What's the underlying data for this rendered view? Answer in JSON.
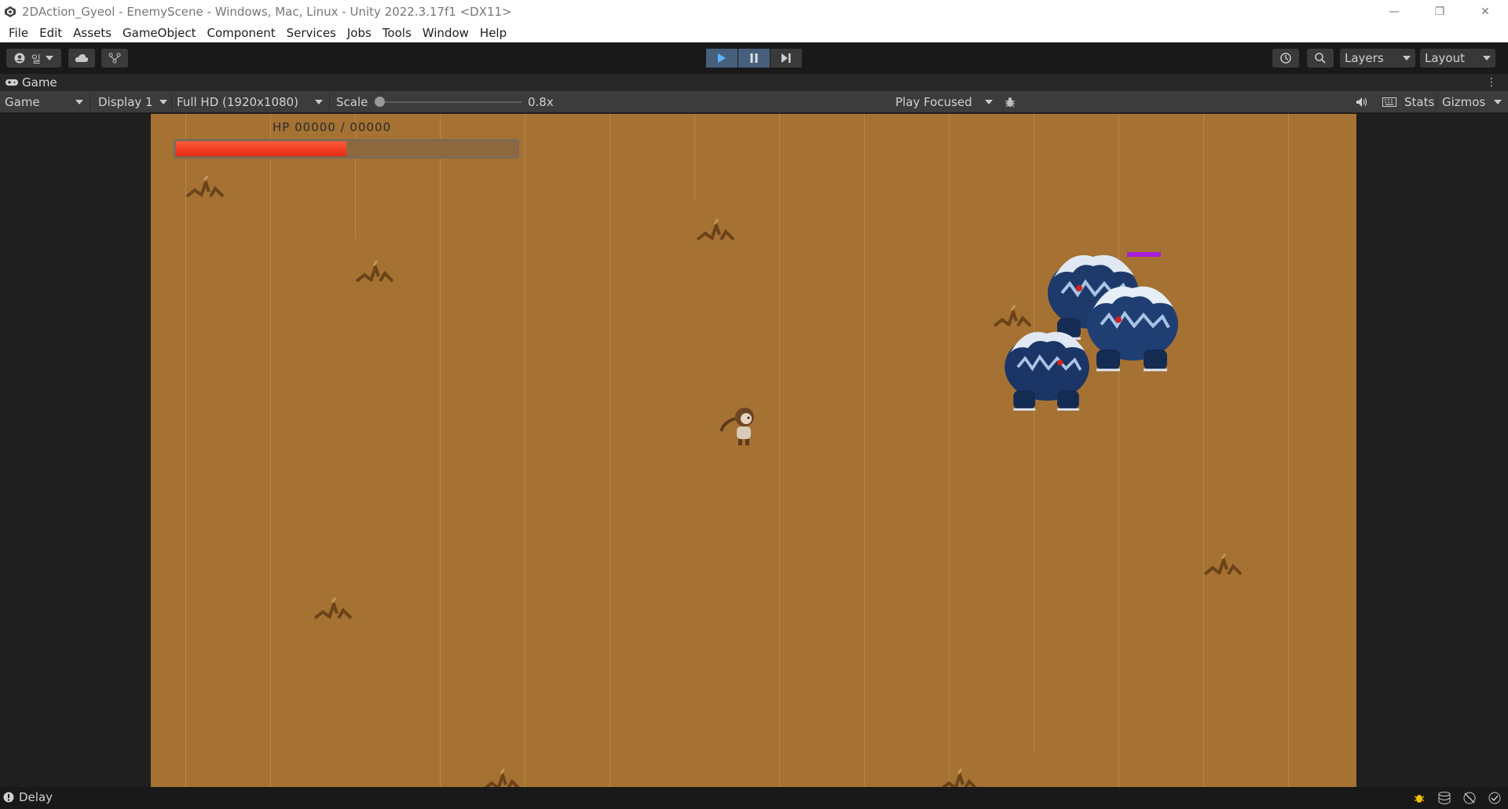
{
  "window": {
    "title": "2DAction_Gyeol - EnemyScene - Windows, Mac, Linux - Unity 2022.3.17f1 <DX11>",
    "controls": {
      "minimize": "—",
      "restore": "❐",
      "close": "✕"
    }
  },
  "menu": [
    "File",
    "Edit",
    "Assets",
    "GameObject",
    "Component",
    "Services",
    "Jobs",
    "Tools",
    "Window",
    "Help"
  ],
  "toolbar": {
    "account_label": "일",
    "layers_label": "Layers",
    "layout_label": "Layout"
  },
  "tab": {
    "label": "Game"
  },
  "gamebar": {
    "mode": "Game",
    "display": "Display 1",
    "resolution": "Full HD (1920x1080)",
    "scale_label": "Scale",
    "scale_value": "0.8x",
    "play_mode": "Play Focused",
    "stats": "Stats",
    "gizmos": "Gizmos"
  },
  "game": {
    "hp_label": "HP  00000  /  00000",
    "player_hp_fraction": 0.5,
    "enemy_count": 3
  },
  "status": {
    "message": "Delay"
  },
  "colors": {
    "ground": "#a57233",
    "hp_fill": "#ff3b1f",
    "enemy_hp": "#a61ed8",
    "play_active": "#46607c"
  }
}
